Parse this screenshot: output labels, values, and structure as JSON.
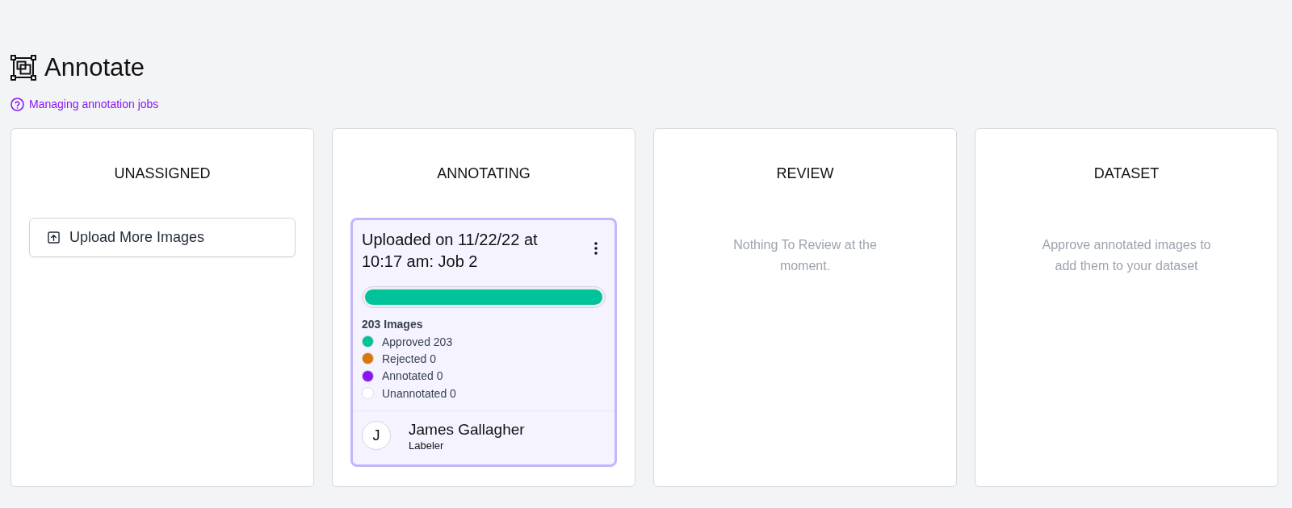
{
  "header": {
    "title": "Annotate",
    "help_link": "Managing annotation jobs"
  },
  "columns": [
    {
      "kind": "actions",
      "title": "UNASSIGNED",
      "button": "Upload More Images"
    },
    {
      "kind": "jobs",
      "title": "ANNOTATING",
      "jobs": [
        {
          "title": "Uploaded on 11/22/22 at 10:17 am: Job 2",
          "progress": {
            "level": 1
          },
          "count": "203 Images",
          "stats": [
            {
              "label": "Approved 203",
              "color": "#00c29b"
            },
            {
              "label": "Rejected 0",
              "color": "#d97706"
            },
            {
              "label": "Annotated 0",
              "color": "#8a15f4"
            },
            {
              "label": "Unannotated 0",
              "color": "#ffffff"
            }
          ],
          "assignee": {
            "initial": "J",
            "name": "James Gallagher",
            "role": "Labeler"
          }
        }
      ]
    },
    {
      "kind": "empty",
      "title": "REVIEW",
      "message": "Nothing To Review at the moment."
    },
    {
      "kind": "empty",
      "title": "DATASET",
      "message": "Approve annotated images to add them to your dataset"
    }
  ]
}
